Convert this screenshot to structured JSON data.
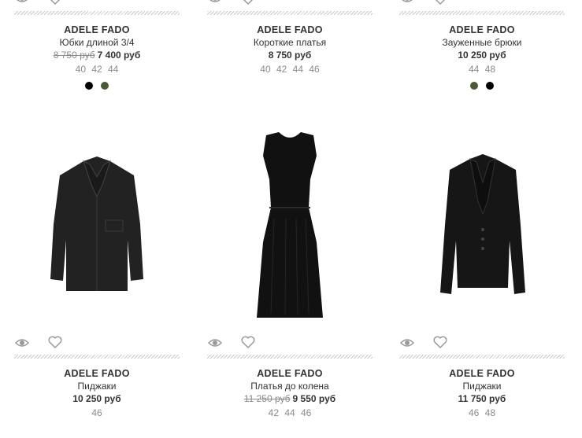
{
  "products": [
    {
      "brand": "ADELE FADO",
      "title": "Юбки длиной 3/4",
      "price_old": "8 750 руб",
      "price": "7 400 руб",
      "sizes": "40 42 44",
      "colors": [
        "#000000",
        "#4b5936"
      ]
    },
    {
      "brand": "ADELE FADO",
      "title": "Короткие платья",
      "price_old": "",
      "price": "8 750 руб",
      "sizes": "40 42 44 46",
      "colors": []
    },
    {
      "brand": "ADELE FADO",
      "title": "Зауженные брюки",
      "price_old": "",
      "price": "10 250 руб",
      "sizes": "44 48",
      "colors": [
        "#4b5936",
        "#000000"
      ]
    },
    {
      "brand": "ADELE FADO",
      "title": "Пиджаки",
      "price_old": "",
      "price": "10 250 руб",
      "sizes": "46",
      "colors": []
    },
    {
      "brand": "ADELE FADO",
      "title": "Платья до колена",
      "price_old": "11 250 руб",
      "price": "9 550 руб",
      "sizes": "42 44 46",
      "colors": []
    },
    {
      "brand": "ADELE FADO",
      "title": "Пиджаки",
      "price_old": "",
      "price": "11 750 руб",
      "sizes": "46 48",
      "colors": []
    }
  ]
}
